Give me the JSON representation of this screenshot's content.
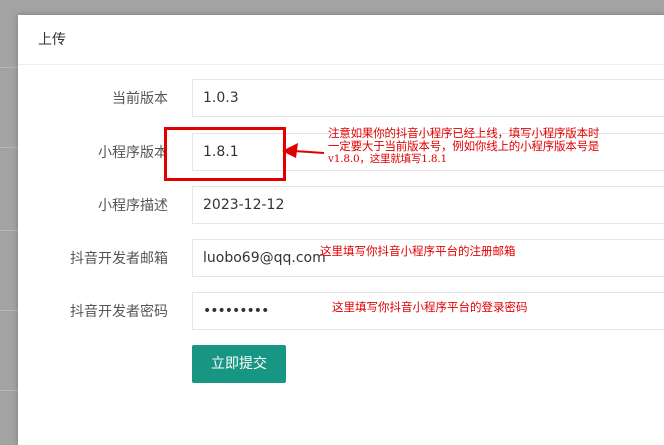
{
  "dialog": {
    "title": "上传",
    "submit_label": "立即提交"
  },
  "form": {
    "current_version": {
      "label": "当前版本",
      "value": "1.0.3"
    },
    "mini_version": {
      "label": "小程序版本",
      "value": "1.8.1"
    },
    "mini_desc": {
      "label": "小程序描述",
      "value": "2023-12-12"
    },
    "dev_email": {
      "label": "抖音开发者邮箱",
      "value": "luobo69@qq.com"
    },
    "dev_password": {
      "label": "抖音开发者密码",
      "value": "•••••••••"
    }
  },
  "annotations": {
    "version_note_line1": "注意如果你的抖音小程序已经上线，填写小程序版本时",
    "version_note_line2": "一定要大于当前版本号，例如你线上的小程序版本号是",
    "version_note_line3": "v1.8.0，这里就填写1.8.1",
    "email_note": "这里填写你抖音小程序平台的注册邮箱",
    "password_note": "这里填写你抖音小程序平台的登录密码",
    "color": "#e00000"
  },
  "colors": {
    "primary_button": "#169683",
    "backdrop": "#a3a3a3"
  }
}
